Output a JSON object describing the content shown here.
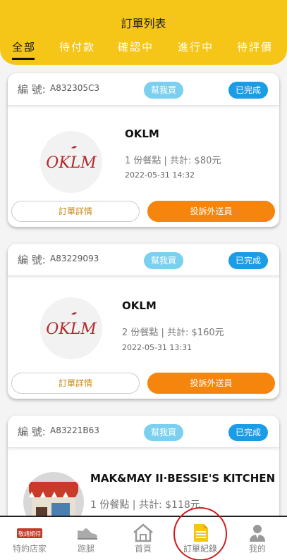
{
  "header": {
    "title": "訂單列表",
    "tabs": [
      {
        "label": "全部",
        "active": true
      },
      {
        "label": "待付款",
        "active": false
      },
      {
        "label": "確認中",
        "active": false
      },
      {
        "label": "進行中",
        "active": false
      },
      {
        "label": "待評價",
        "active": false
      }
    ]
  },
  "orders": [
    {
      "number_label": "編 號:",
      "number": "A832305C3",
      "help_badge": "幫我買",
      "status": "已完成",
      "logo_text": "OKLM",
      "store": "OKLM",
      "summary": "1 份餐點 | 共計: $80元",
      "date": "2022-05-31 14:32",
      "detail_button": "訂單詳情",
      "complain_button": "投訴外送員"
    },
    {
      "number_label": "編 號:",
      "number": "A83229093",
      "help_badge": "幫我買",
      "status": "已完成",
      "logo_text": "OKLM",
      "store": "OKLM",
      "summary": "2 份餐點 | 共計: $160元",
      "date": "2022-05-31 13:31",
      "detail_button": "訂單詳情",
      "complain_button": "投訴外送員"
    },
    {
      "number_label": "編 號:",
      "number": "A83221B63",
      "help_badge": "幫我買",
      "status": "已完成",
      "store": "MAK&MAY II·BESSIE'S KITCHEN",
      "summary": "1 份餐點 | 共計: $118元"
    }
  ],
  "bottom_nav": {
    "items": [
      {
        "label": "特約店家",
        "icon": "store-icon",
        "badge": "敬請期待"
      },
      {
        "label": "跑腿",
        "icon": "shoe-icon"
      },
      {
        "label": "首頁",
        "icon": "home-icon"
      },
      {
        "label": "訂單紀錄",
        "icon": "document-icon",
        "active": true
      },
      {
        "label": "我的",
        "icon": "user-icon"
      }
    ]
  },
  "colors": {
    "header": "#f5c518",
    "status_badge": "#1a9ce6",
    "help_badge": "#7cd0ef",
    "complain_button": "#f5850c",
    "detail_text": "#c6891a",
    "highlight_circle": "#d01c1c"
  }
}
